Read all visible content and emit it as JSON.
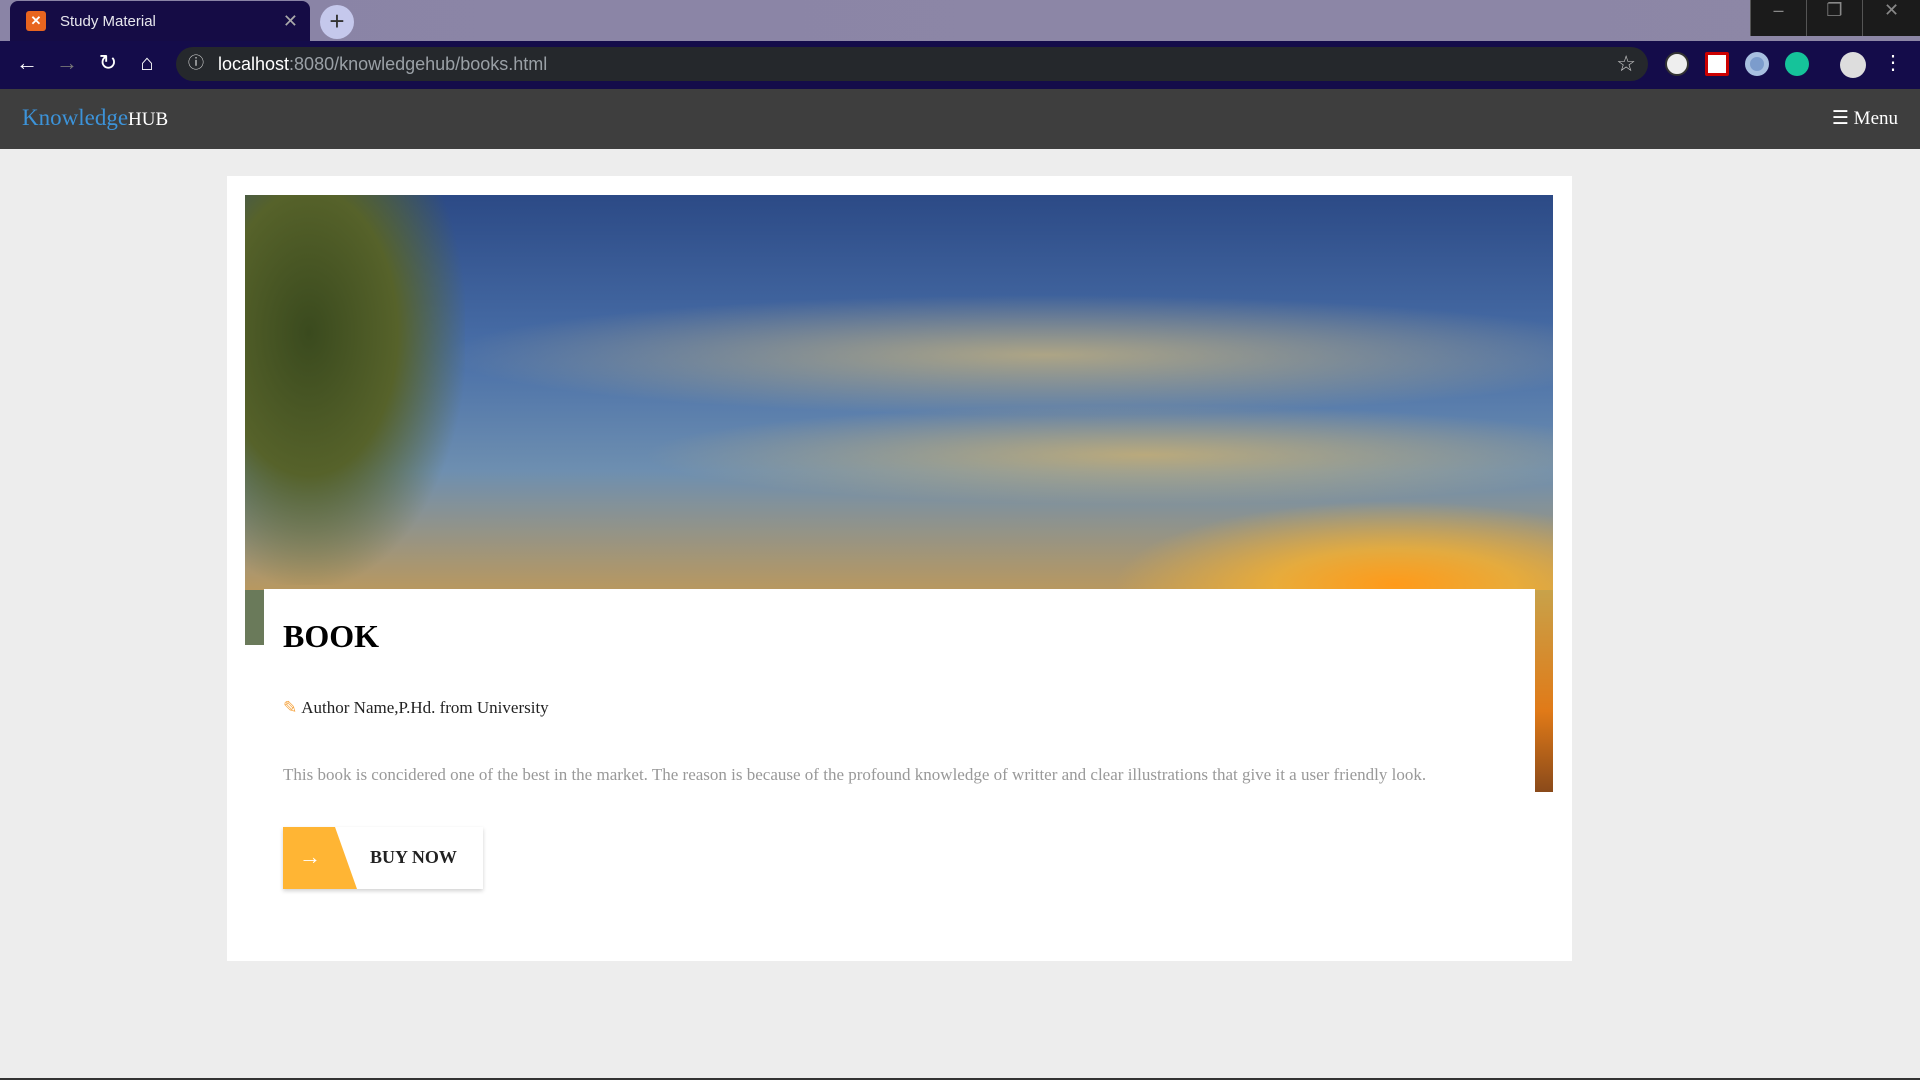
{
  "browser": {
    "tab_title": "Study Material",
    "url_host": "localhost",
    "url_rest": ":8080/knowledgehub/books.html"
  },
  "navbar": {
    "brand_main": "Knowledge",
    "brand_suffix": "HUB",
    "menu_label": "Menu"
  },
  "book": {
    "title": "BOOK",
    "author": "Author Name,P.Hd. from University",
    "description": "This book is concidered one of the best in the market. The reason is because of the profound knowledge of writter and clear illustrations that give it a user friendly look.",
    "buy_label": "BUY NOW"
  },
  "colors": {
    "accent": "#ffb534",
    "brand": "#3c93d9",
    "navbar": "#3e3e3e"
  }
}
